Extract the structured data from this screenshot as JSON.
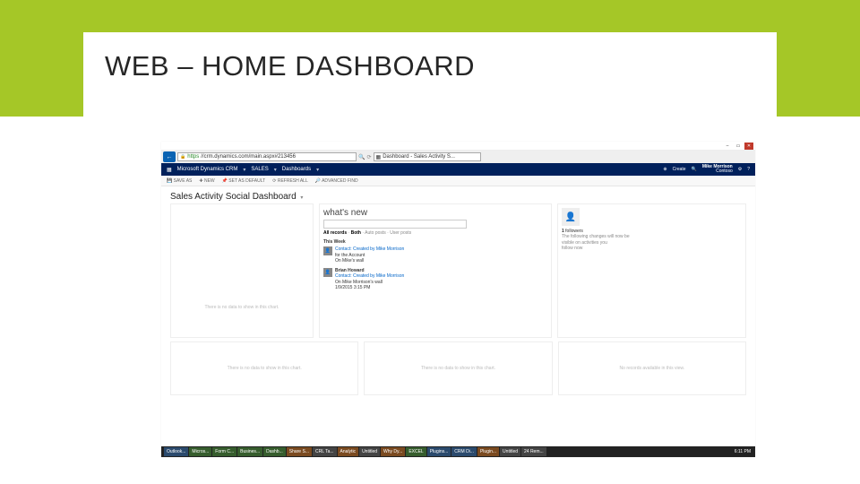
{
  "slide": {
    "title": "WEB – HOME DASHBOARD"
  },
  "window": {
    "close": "✕",
    "max": "▭",
    "min": "–"
  },
  "browser": {
    "back": "←",
    "url_prefix": "https",
    "url": " //crm.dynamics.com/main.aspx#213456",
    "search_icon": "🔍",
    "refresh_icon": "⟳",
    "tab_icon": "▦",
    "tab_title": "Dashboard - Sales Activity S..."
  },
  "appnav": {
    "brand": "Microsoft Dynamics CRM",
    "caret": "▾",
    "area": "SALES",
    "page": "Dashboards",
    "create_label": "Create",
    "user_name": "Mike Morrison",
    "user_org": "Contoso"
  },
  "ribbon": {
    "save_as": "SAVE AS",
    "new": "NEW",
    "set_default": "SET AS DEFAULT",
    "refresh": "REFRESH ALL",
    "advanced_find": "ADVANCED FIND"
  },
  "dashboard": {
    "title": "Sales Activity Social Dashboard",
    "caret": "▾"
  },
  "panels": {
    "left_placeholder": "There is no data to show in this chart.",
    "row2_a": "There is no data to show in this chart.",
    "row2_b": "There is no data to show in this chart.",
    "row2_c": "No records available in this view."
  },
  "whatsnew": {
    "title": "what's new",
    "filters_all": "All records",
    "filters_sep": " · ",
    "filters_both": "Both",
    "filters_auto": "Auto posts",
    "filters_user": "User posts",
    "section": "This Week",
    "post1": {
      "title": "Contact: Created by Mike Morrison",
      "line2": "for the Account",
      "line3": "On Mike's wall"
    },
    "post2": {
      "title": "Brian Howard",
      "line2": "Contact: Created by Mike Morrison",
      "line3": "On Mike Morrison's wall",
      "line4": "1/9/2015 3:15 PM"
    }
  },
  "followpane": {
    "count": "1",
    "label": "followers",
    "text1": "The following changes will now be",
    "text2": "visible on activities you",
    "text3": "follow now"
  },
  "taskbar": {
    "items": [
      "Outlook...",
      "Micros...",
      "Form C...",
      "Busines...",
      "Dashb...",
      "Share S...",
      "CRL Ta...",
      "Analytic",
      "Untitled",
      "Why Dy...",
      "EXCEL",
      "Plugins...",
      "CRM Di...",
      "Plugin...",
      "Untitled",
      "24 Rem..."
    ],
    "time": "6:11 PM"
  }
}
